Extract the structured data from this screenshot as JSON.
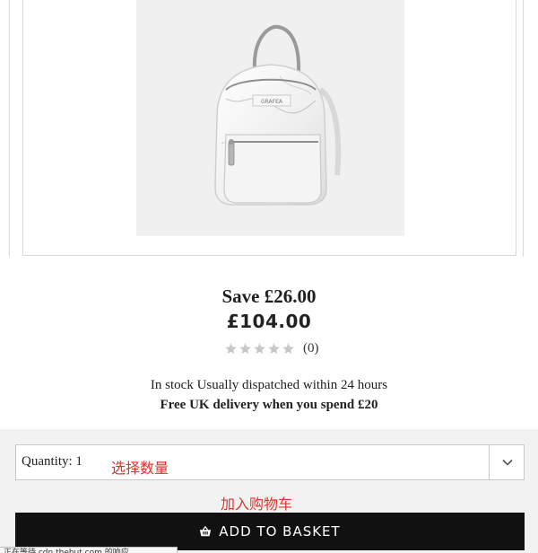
{
  "product": {
    "image_alt": "Marble print mini backpack",
    "brand_on_bag": "GRAFEA",
    "save_text": "Save £26.00",
    "price": "£104.00",
    "rating_stars": 0,
    "rating_max": 5,
    "review_count": "(0)",
    "stock_text": "In stock Usually dispatched within 24 hours",
    "delivery_text": "Free UK delivery when you spend £20"
  },
  "purchase": {
    "quantity_label": "Quantity: 1",
    "quantity_options": [
      "Quantity: 1"
    ],
    "add_button_label": "ADD TO BASKET"
  },
  "annotations": {
    "select_quantity": "选择数量",
    "add_to_cart": "加入购物车"
  },
  "status_bar": {
    "text": "正在等待 cdn.thehut.com 的响应..."
  },
  "colors": {
    "button_bg": "#111111",
    "button_text": "#ffffff",
    "annotation": "#e0322e",
    "panel_bg": "#f2f2f2",
    "star_empty": "#c8c8c8"
  },
  "icons": {
    "rating": "star-icon",
    "dropdown": "chevron-down-icon",
    "basket": "basket-icon"
  }
}
